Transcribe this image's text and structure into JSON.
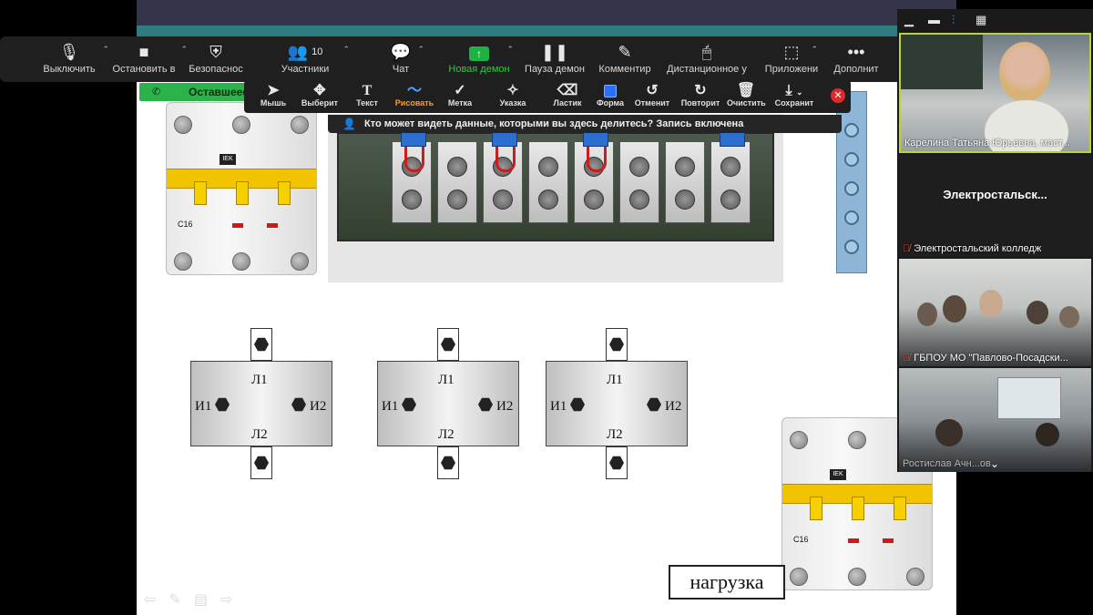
{
  "zoom_toolbar": {
    "items": [
      {
        "label": "Выключить",
        "icon": "microphone-icon"
      },
      {
        "label": "Остановить в",
        "icon": "video-camera-icon"
      },
      {
        "label": "Безопаснос",
        "icon": "shield-icon"
      },
      {
        "label": "Участники",
        "icon": "participants-icon",
        "count": "10"
      },
      {
        "label": "Чат",
        "icon": "chat-icon"
      },
      {
        "label": "Новая демон",
        "icon": "share-screen-icon"
      },
      {
        "label": "Пауза демон",
        "icon": "pause-icon"
      },
      {
        "label": "Комментир",
        "icon": "annotate-pencil-icon"
      },
      {
        "label": "Дистанционное у",
        "icon": "mouse-icon"
      },
      {
        "label": "Приложени",
        "icon": "apps-icon"
      },
      {
        "label": "Дополнит",
        "icon": "more-dots-icon"
      }
    ]
  },
  "remaining_label": "Оставшеес",
  "annotation_toolbar": {
    "items": [
      {
        "label": "Мышь",
        "icon": "mouse-pointer-icon"
      },
      {
        "label": "Выберит",
        "icon": "select-move-icon"
      },
      {
        "label": "Текст",
        "icon": "text-icon"
      },
      {
        "label": "Рисовать",
        "icon": "draw-squiggle-icon"
      },
      {
        "label": "Метка",
        "icon": "stamp-check-icon"
      },
      {
        "label": "Указка",
        "icon": "spotlight-icon"
      },
      {
        "label": "Ластик",
        "icon": "eraser-icon"
      },
      {
        "label": "Форма",
        "icon": "shape-square-icon"
      },
      {
        "label": "Отменит",
        "icon": "undo-icon"
      },
      {
        "label": "Повторит",
        "icon": "redo-icon"
      },
      {
        "label": "Очистить",
        "icon": "trash-icon"
      },
      {
        "label": "Сохранит",
        "icon": "save-download-icon"
      }
    ],
    "active_index": 3
  },
  "share_notice": "Кто может видеть данные, которыми вы здесь делитесь? Запись включена",
  "slide": {
    "breaker_brand": "IEK",
    "breaker_rating": "C16",
    "transformers": [
      {
        "top": "Л1",
        "bottom": "Л2",
        "left": "И1",
        "right": "И2"
      },
      {
        "top": "Л1",
        "bottom": "Л2",
        "left": "И1",
        "right": "И2"
      },
      {
        "top": "Л1",
        "bottom": "Л2",
        "left": "И1",
        "right": "И2"
      }
    ],
    "load_label": "нагрузка"
  },
  "participants": [
    {
      "name": "Карелина Татьяна Юрьевна, маст...",
      "muted": false
    },
    {
      "name": "Электростальский колледж",
      "center": "Электростальск...",
      "muted": true
    },
    {
      "name": "ГБПОУ МО \"Павлово-Посадски...",
      "muted": true
    },
    {
      "name": "Ростислав Ачн...ов",
      "muted": false
    }
  ],
  "colors": {
    "toolbar_bg": "#1f1f1f",
    "share_green": "#1fb141",
    "active_tool": "#ff9a2e",
    "speaker_border": "#b9d33a",
    "muted_red": "#ff4040"
  }
}
